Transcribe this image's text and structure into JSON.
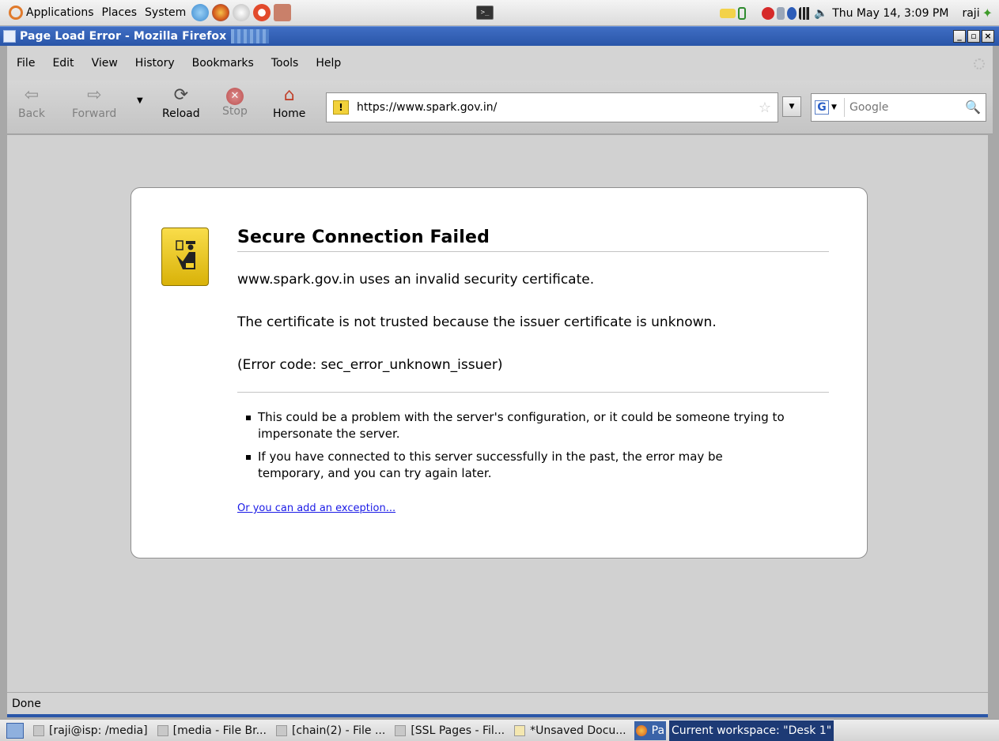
{
  "panel": {
    "menus": [
      "Applications",
      "Places",
      "System"
    ],
    "clock": "Thu May 14,  3:09 PM",
    "user": "raji"
  },
  "window": {
    "title": "Page Load Error - Mozilla Firefox"
  },
  "menubar": {
    "items": [
      "File",
      "Edit",
      "View",
      "History",
      "Bookmarks",
      "Tools",
      "Help"
    ]
  },
  "toolbar": {
    "back": "Back",
    "forward": "Forward",
    "reload": "Reload",
    "stop": "Stop",
    "home": "Home",
    "url": "https://www.spark.gov.in/",
    "search_placeholder": "Google"
  },
  "error": {
    "title": "Secure Connection Failed",
    "description": "www.spark.gov.in uses an invalid security certificate.",
    "reason": "The certificate is not trusted because the issuer certificate is unknown.",
    "code": "(Error code: sec_error_unknown_issuer)",
    "bullets": [
      "This could be a problem with the server's configuration, or it could be someone trying to impersonate the server.",
      "If you have connected to this server successfully in the past, the error may be temporary, and you can try again later."
    ],
    "exception_link": "Or you can add an exception..."
  },
  "status": {
    "text": "Done"
  },
  "taskbar": {
    "tasks": [
      {
        "label": "[raji@isp: /media]",
        "icon": "terminal-icon"
      },
      {
        "label": "[media - File Br...",
        "icon": "folder-icon"
      },
      {
        "label": "[chain(2) - File ...",
        "icon": "folder-icon"
      },
      {
        "label": "[SSL Pages - Fil...",
        "icon": "folder-icon"
      },
      {
        "label": "*Unsaved Docu...",
        "icon": "text-editor-icon"
      },
      {
        "label": "Pa",
        "icon": "firefox-icon"
      }
    ],
    "workspace": "Current workspace: \"Desk 1\""
  }
}
